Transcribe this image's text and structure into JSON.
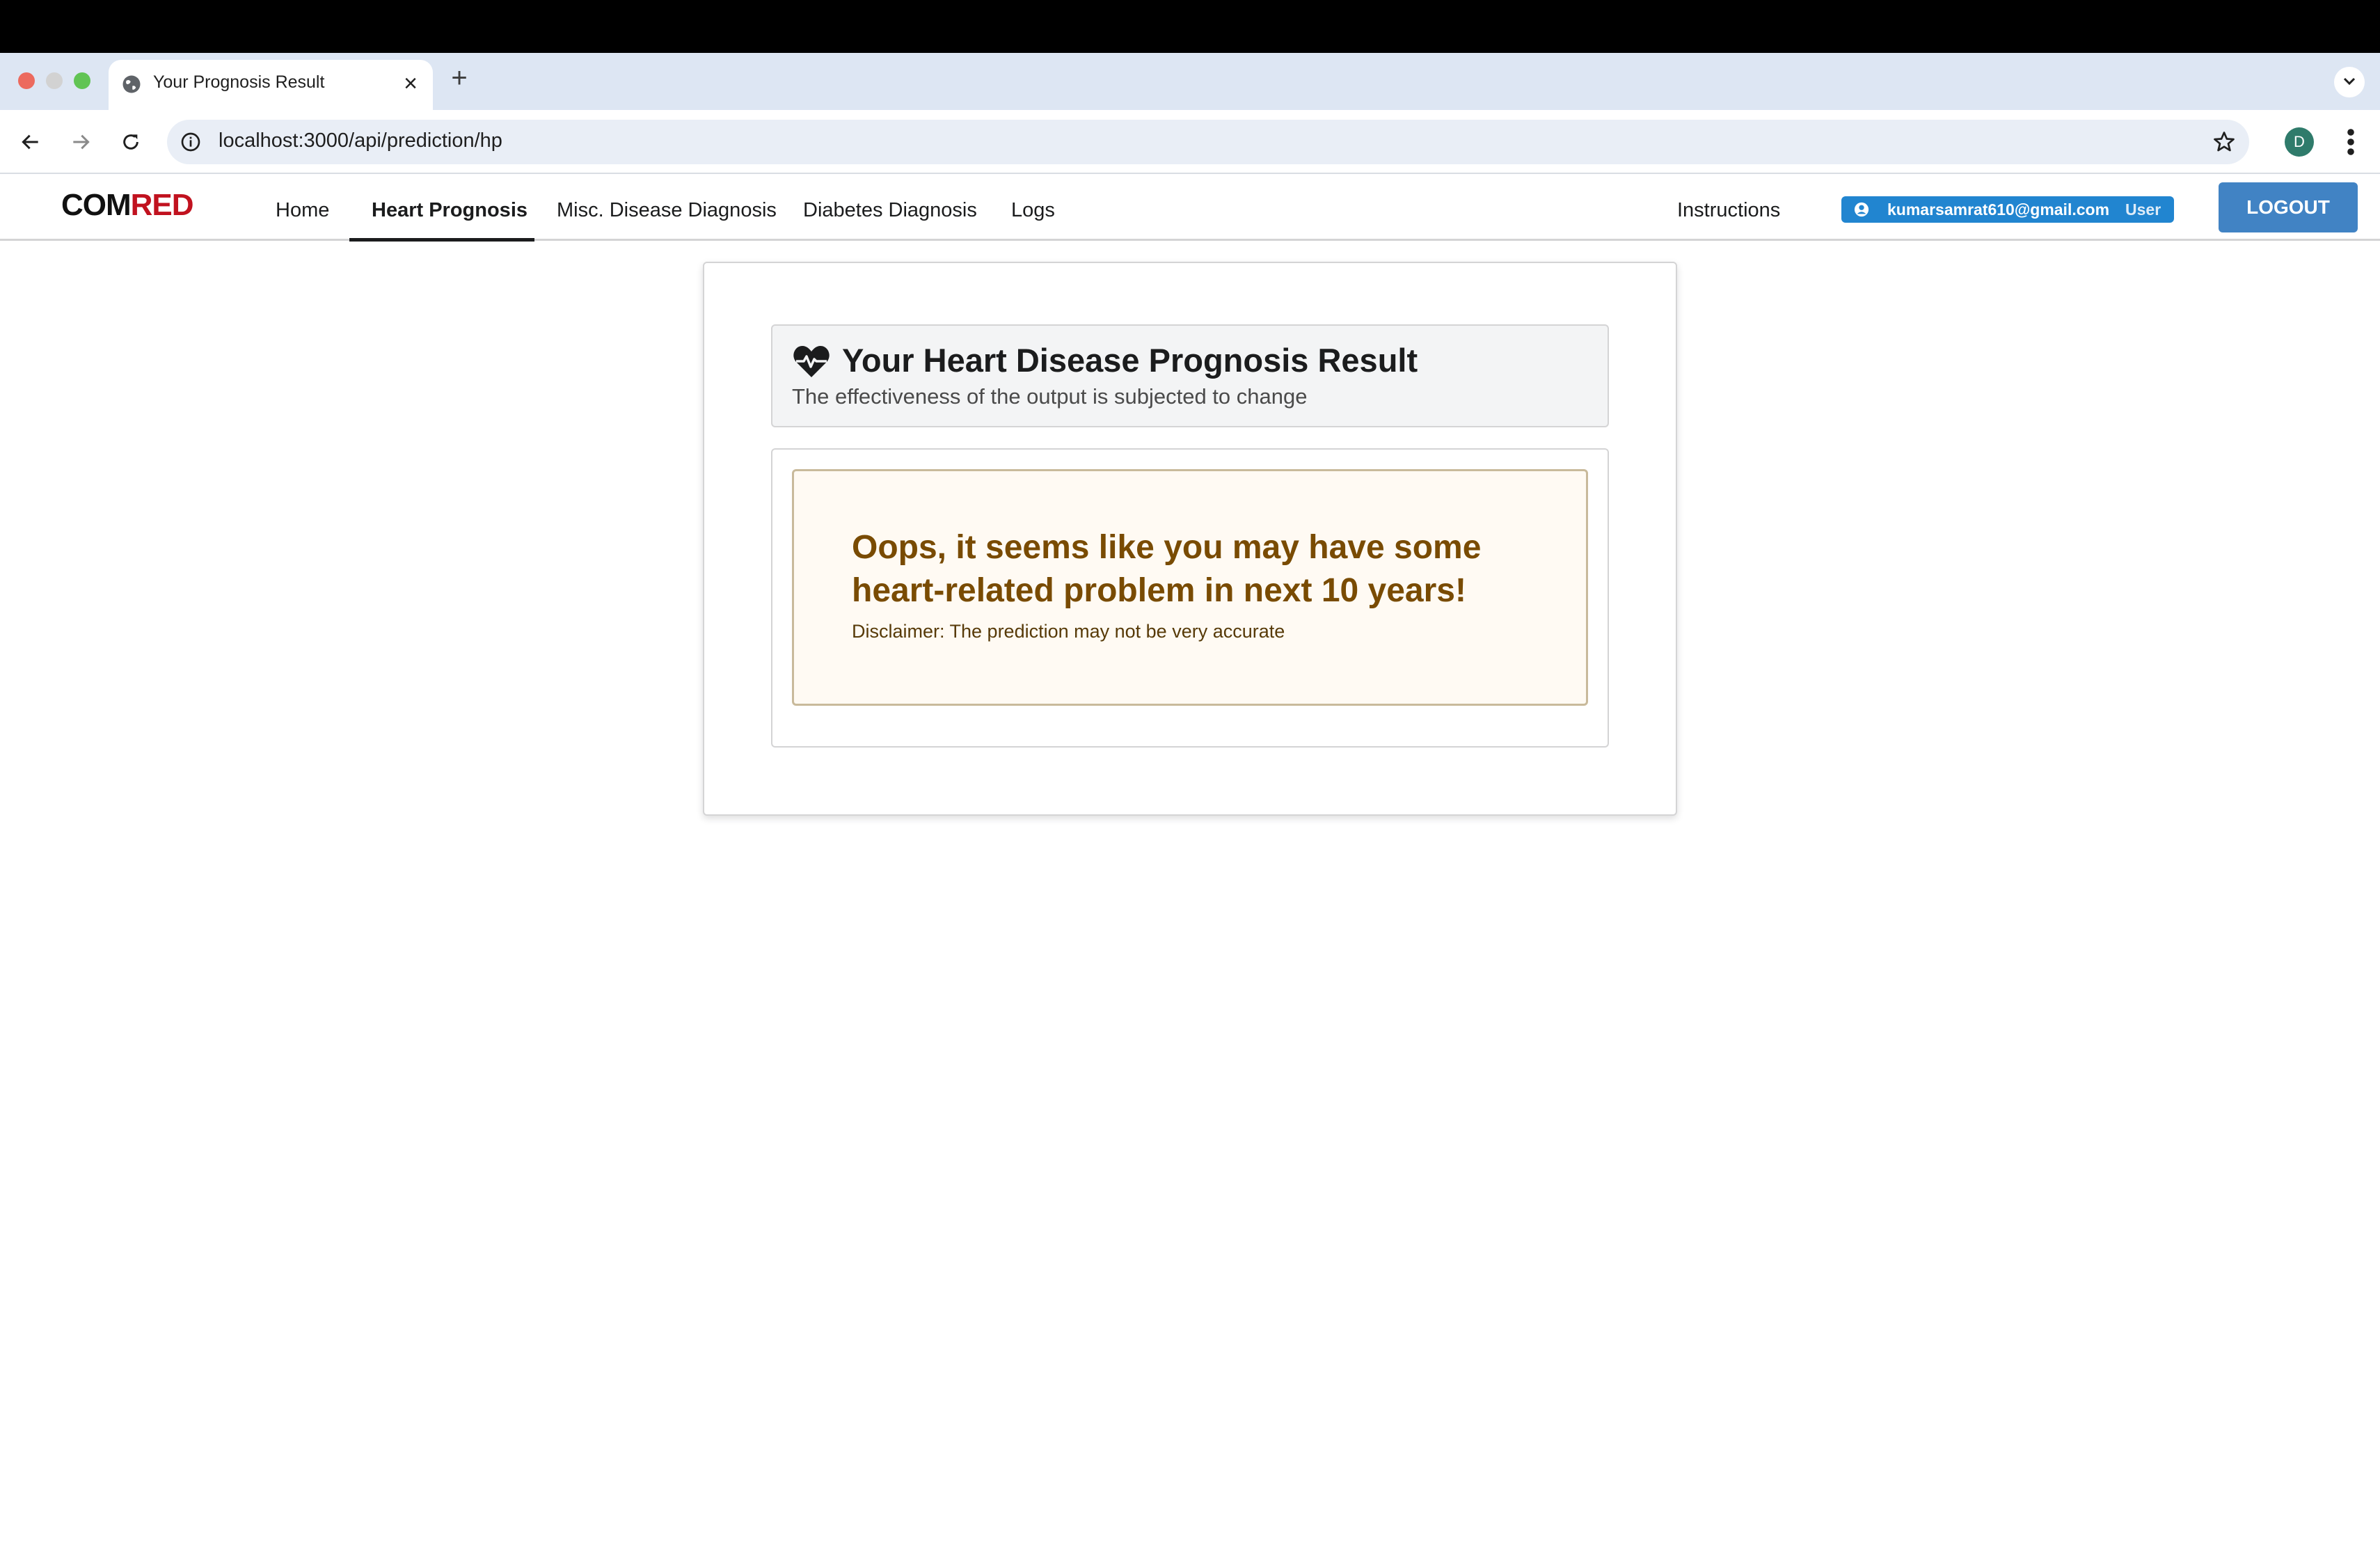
{
  "browser": {
    "tab_title": "Your Prognosis Result",
    "new_tab": "+",
    "close": "×",
    "url": "localhost:3000/api/prediction/hp",
    "profile_initial": "D"
  },
  "navbar": {
    "brand_part1": "COM",
    "brand_part2": "RED",
    "items": [
      {
        "label": "Home"
      },
      {
        "label": "Heart Prognosis"
      },
      {
        "label": "Misc. Disease Diagnosis"
      },
      {
        "label": "Diabetes Diagnosis"
      },
      {
        "label": "Logs"
      }
    ],
    "active_item": "Heart Prognosis",
    "instructions": "Instructions",
    "user_email": "kumarsamrat610@gmail.com",
    "user_role": "User",
    "logout": "LOGOUT"
  },
  "result": {
    "title": "Your Heart Disease Prognosis Result",
    "subtitle": "The effectiveness of the output is subjected to change",
    "message": "Oops, it seems like you may have some heart-related problem in next 10 years!",
    "disclaimer": "Disclaimer: The prediction may not be very accurate"
  },
  "colors": {
    "brand_red": "#c1121f",
    "primary_blue": "#4183c4",
    "badge_blue": "#2185d0",
    "warning_text": "#794b02",
    "warning_bg": "#fffaf3"
  },
  "icons": {
    "tab_favicon": "globe-icon",
    "header": "heartbeat-icon",
    "badge": "user-circle-icon"
  }
}
